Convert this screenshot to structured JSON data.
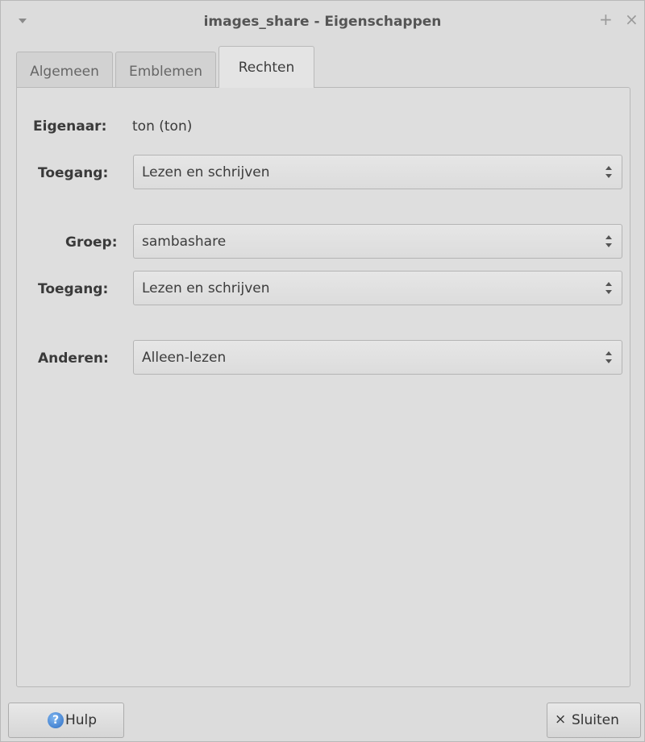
{
  "window": {
    "title": "images_share - Eigenschappen",
    "menu_icon": "triangle-down-icon",
    "maximize_symbol": "+",
    "close_symbol": "×"
  },
  "tabs": [
    {
      "label": "Algemeen",
      "active": false
    },
    {
      "label": "Emblemen",
      "active": false
    },
    {
      "label": "Rechten",
      "active": true
    }
  ],
  "permissions": {
    "owner_label": "Eigenaar:",
    "owner_value": "ton (ton)",
    "owner_access_label": "Toegang:",
    "owner_access_value": "Lezen en schrijven",
    "group_label": "Groep:",
    "group_value": "sambashare",
    "group_access_label": "Toegang:",
    "group_access_value": "Lezen en schrijven",
    "others_label": "Anderen:",
    "others_value": "Alleen-lezen"
  },
  "buttons": {
    "help_label": "Hulp",
    "help_icon_glyph": "?",
    "close_label": "Sluiten",
    "close_icon_glyph": "×"
  }
}
